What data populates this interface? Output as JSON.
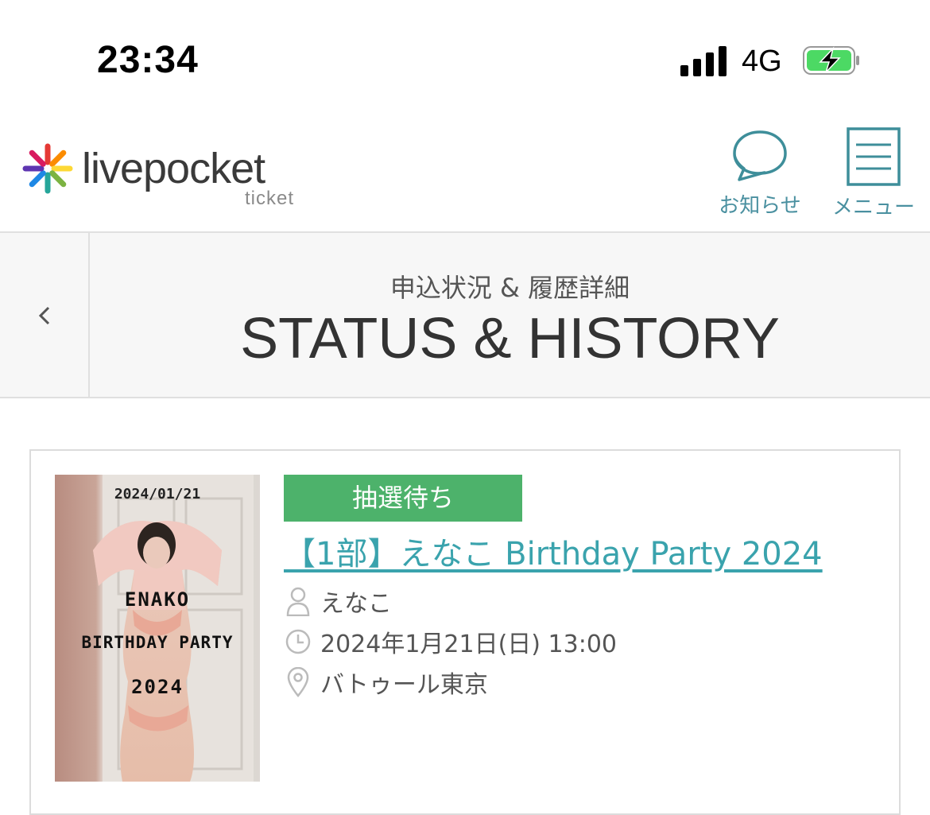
{
  "status_bar": {
    "time": "23:34",
    "network": "4G"
  },
  "header": {
    "logo_text": "livepocket",
    "logo_sub": "ticket",
    "news_label": "お知らせ",
    "menu_label": "メニュー"
  },
  "title_bar": {
    "title_jp": "申込状況 & 履歴詳細",
    "title_en": "STATUS & HISTORY"
  },
  "card": {
    "status_badge": "抽選待ち",
    "event_title": "【1部】えなこ Birthday Party 2024",
    "performer": "えなこ",
    "datetime": "2024年1月21日(日) 13:00",
    "venue": "バトゥール東京",
    "poster": {
      "date": "2024/01/21",
      "line1": "ENAKO",
      "line2": "BIRTHDAY PARTY",
      "line3": "2024"
    }
  },
  "colors": {
    "accent_teal": "#3aa3ad",
    "badge_green": "#4db26b",
    "battery_green": "#4cd964"
  },
  "icons": {
    "news": "speech-bubble-icon",
    "menu": "hamburger-menu-icon",
    "back": "chevron-left-icon",
    "performer": "person-icon",
    "datetime": "clock-icon",
    "venue": "location-pin-icon"
  }
}
